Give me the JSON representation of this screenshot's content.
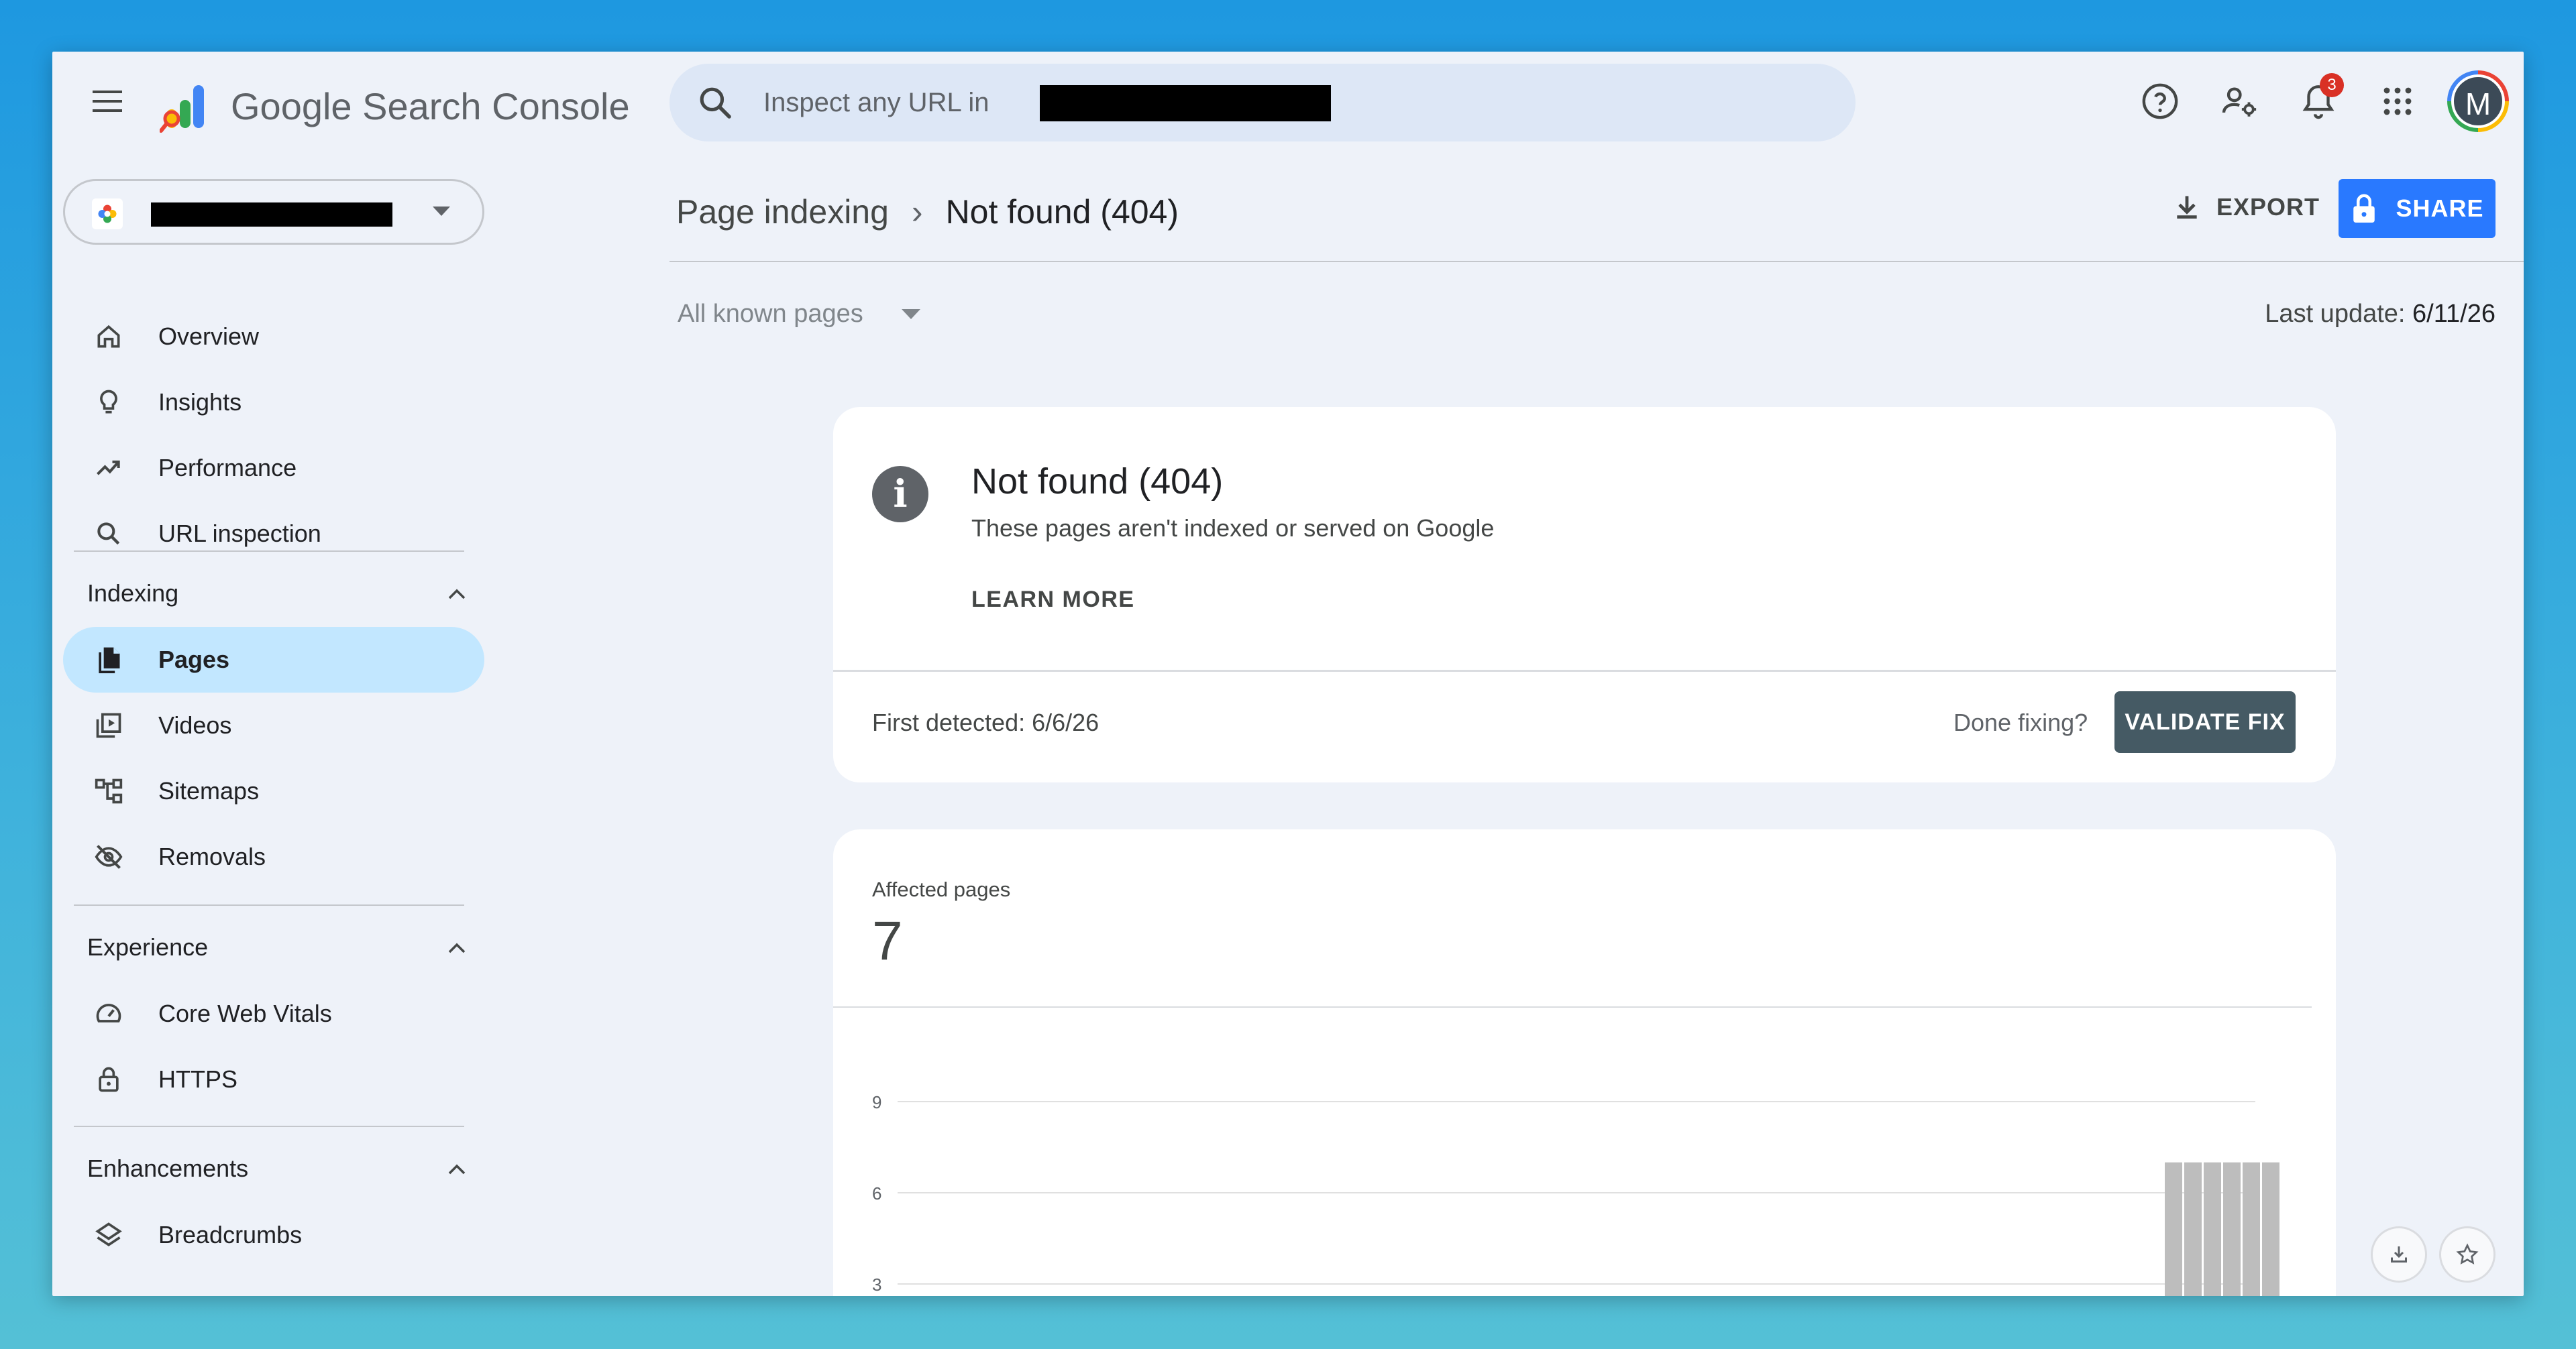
{
  "app": {
    "title": "Google Search Console",
    "search_placeholder": "Inspect any URL in",
    "notification_count": "3",
    "avatar_initial": "M",
    "accent_color": "#2979ff"
  },
  "sidebar": {
    "top_items": [
      {
        "label": "Overview",
        "icon": "home-icon"
      },
      {
        "label": "Insights",
        "icon": "lightbulb-icon"
      },
      {
        "label": "Performance",
        "icon": "trending-up-icon"
      },
      {
        "label": "URL inspection",
        "icon": "search-icon"
      }
    ],
    "sections": [
      {
        "title": "Indexing",
        "items": [
          {
            "label": "Pages",
            "icon": "pages-icon",
            "active": true
          },
          {
            "label": "Videos",
            "icon": "video-library-icon"
          },
          {
            "label": "Sitemaps",
            "icon": "sitemap-icon"
          },
          {
            "label": "Removals",
            "icon": "visibility-off-icon"
          }
        ]
      },
      {
        "title": "Experience",
        "items": [
          {
            "label": "Core Web Vitals",
            "icon": "speed-icon"
          },
          {
            "label": "HTTPS",
            "icon": "lock-icon"
          }
        ]
      },
      {
        "title": "Enhancements",
        "items": [
          {
            "label": "Breadcrumbs",
            "icon": "layers-icon"
          }
        ]
      }
    ]
  },
  "header": {
    "breadcrumb_parent": "Page indexing",
    "breadcrumb_current": "Not found (404)",
    "export_label": "EXPORT",
    "share_label": "SHARE",
    "filter_label": "All known pages",
    "last_update_label": "Last update:",
    "last_update_value": "6/11/26"
  },
  "issue_card": {
    "title": "Not found (404)",
    "subtitle": "These pages aren't indexed or served on Google",
    "learn_more": "LEARN MORE",
    "first_detected": "First detected: 6/6/26",
    "done_fixing": "Done fixing?",
    "validate_label": "VALIDATE FIX"
  },
  "affected_card": {
    "label": "Affected pages",
    "value": "7"
  },
  "chart_data": {
    "type": "bar",
    "yticks": [
      "9",
      "6",
      "3"
    ],
    "ylim": [
      0,
      9
    ],
    "values": [
      7,
      7,
      7,
      7,
      7,
      7
    ],
    "bar_color": "#bdbdbd",
    "grid": true
  }
}
